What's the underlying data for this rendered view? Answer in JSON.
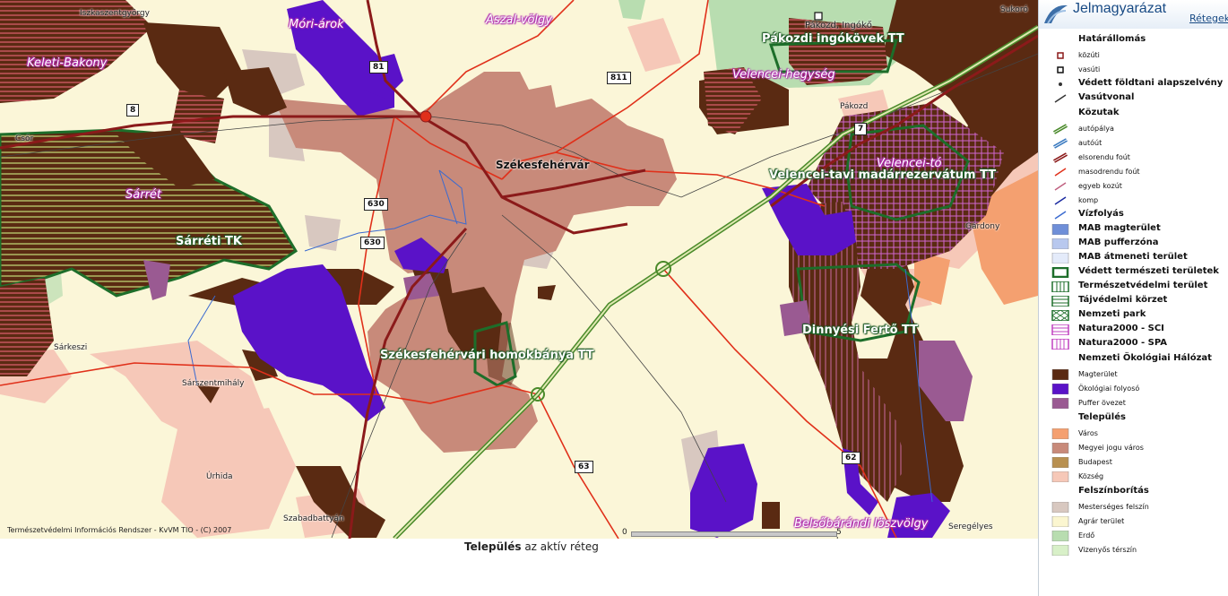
{
  "map": {
    "labels": {
      "iszkaszentgyorgy": "Iszkaszentgyörgy",
      "mori_arok": "Móri-árok",
      "aszal_volgy": "Aszal-völgy",
      "sukoro": "Sukoró",
      "pakozd_ingoko": "Pákozd, Ingókő",
      "pakozdi_ingokovek": "Pákozdi ingókövek TT",
      "keleti_bakony": "Keleti-Bakony",
      "velencei_hegyseg": "Velencei-hegység",
      "pakozd": "Pákozd",
      "csor": "Csór",
      "szekesfehervar": "Székesfehérvár",
      "velencei_to": "Velencei-tó",
      "velencei_tavi": "Velencei-tavi madárrezervátum TT",
      "sarret": "Sárrét",
      "gardony": "Gárdony",
      "sarreti_tk": "Sárréti TK",
      "dinnyesi_ferto": "Dinnyési Fertő TT",
      "sarkeszi": "Sárkeszi",
      "homokbanya": "Székesfehérvári homokbánya TT",
      "sarszentmihaly": "Sárszentmihály",
      "urhida": "Úrhida",
      "szabadbattyan": "Szabadbattyán",
      "belsobarandi": "Belsőbárándi löszvölgy",
      "seregelyes": "Seregélyes"
    },
    "road_shields": {
      "r81": "81",
      "r811": "811",
      "r8": "8",
      "r7": "7",
      "r630a": "630",
      "r630b": "630",
      "r63": "63",
      "r62": "62"
    },
    "copyright": "Természetvédelmi Információs Rendszer - KvVM TIO - (C) 2007",
    "scale_zero": "0",
    "scale_end": "5 km"
  },
  "status": {
    "active_layer": "Település",
    "suffix": " az aktív réteg"
  },
  "legend": {
    "title": "Jelmagyarázat",
    "tab_link": "Rétegek",
    "items": [
      {
        "kind": "section",
        "label": "Határállomás"
      },
      {
        "kind": "item",
        "label": "közúti",
        "symbol": "square-border",
        "color": "#8b1a1a"
      },
      {
        "kind": "item",
        "label": "vasúti",
        "symbol": "square-border",
        "color": "#111111"
      },
      {
        "kind": "item",
        "label": "Védett földtani alapszelvény",
        "symbol": "dot",
        "color": "#333333",
        "big": true
      },
      {
        "kind": "item",
        "label": "Vasútvonal",
        "symbol": "line",
        "color": "#333333",
        "big": true
      },
      {
        "kind": "section",
        "label": "Közutak"
      },
      {
        "kind": "item",
        "label": "autópálya",
        "symbol": "road",
        "color": "#4a8a2a"
      },
      {
        "kind": "item",
        "label": "autóút",
        "symbol": "road",
        "color": "#3a7ac0"
      },
      {
        "kind": "item",
        "label": "elsorendu foút",
        "symbol": "road",
        "color": "#8b1a1a"
      },
      {
        "kind": "item",
        "label": "masodrendu foút",
        "symbol": "line",
        "color": "#e0301a"
      },
      {
        "kind": "item",
        "label": "egyeb kozút",
        "symbol": "line",
        "color": "#c06080"
      },
      {
        "kind": "item",
        "label": "komp",
        "symbol": "line",
        "color": "#1a2aa0"
      },
      {
        "kind": "item",
        "label": "Vízfolyás",
        "symbol": "line",
        "color": "#3a6ad0",
        "big": true
      },
      {
        "kind": "item",
        "label": "MAB magterület",
        "symbol": "fill",
        "color": "#6f8fd8",
        "big": true
      },
      {
        "kind": "item",
        "label": "MAB pufferzóna",
        "symbol": "fill",
        "color": "#b8c8ee",
        "big": true
      },
      {
        "kind": "item",
        "label": "MAB átmeneti terület",
        "symbol": "fill",
        "color": "#e4ebfa",
        "big": true
      },
      {
        "kind": "item",
        "label": "Védett természeti területek",
        "symbol": "outline",
        "color": "#1d6e2a",
        "big": true
      },
      {
        "kind": "item",
        "label": "Természetvédelmi terület",
        "symbol": "vhatch",
        "color": "#1d6e2a",
        "big": true
      },
      {
        "kind": "item",
        "label": "Tájvédelmi körzet",
        "symbol": "hhatch",
        "color": "#1d6e2a",
        "big": true
      },
      {
        "kind": "item",
        "label": "Nemzeti park",
        "symbol": "cross",
        "color": "#1d6e2a",
        "big": true
      },
      {
        "kind": "item",
        "label": "Natura2000 - SCI",
        "symbol": "hhatch",
        "color": "#c040c0",
        "big": true
      },
      {
        "kind": "item",
        "label": "Natura2000 - SPA",
        "symbol": "vhatch",
        "color": "#c040c0",
        "big": true
      },
      {
        "kind": "section",
        "label": "Nemzeti Ökológiai Hálózat"
      },
      {
        "kind": "item",
        "label": "Magterület",
        "symbol": "fill",
        "color": "#5a2a12"
      },
      {
        "kind": "item",
        "label": "Ökológiai folyosó",
        "symbol": "fill",
        "color": "#5a12c8"
      },
      {
        "kind": "item",
        "label": "Puffer övezet",
        "symbol": "fill",
        "color": "#9a5a92"
      },
      {
        "kind": "section",
        "label": "Település"
      },
      {
        "kind": "item",
        "label": "Város",
        "symbol": "fill",
        "color": "#f4a070"
      },
      {
        "kind": "item",
        "label": "Megyei jogu város",
        "symbol": "fill",
        "color": "#c88a7a"
      },
      {
        "kind": "item",
        "label": "Budapest",
        "symbol": "fill",
        "color": "#b89050"
      },
      {
        "kind": "item",
        "label": "Község",
        "symbol": "fill",
        "color": "#f6c8b8"
      },
      {
        "kind": "section",
        "label": "Felszínborítás"
      },
      {
        "kind": "item",
        "label": "Mesterséges felszín",
        "symbol": "fill",
        "color": "#d8c8c0"
      },
      {
        "kind": "item",
        "label": "Agrár terület",
        "symbol": "fill",
        "color": "#fbf6d0"
      },
      {
        "kind": "item",
        "label": "Erdő",
        "symbol": "fill",
        "color": "#b8ddb0"
      },
      {
        "kind": "item",
        "label": "Vizenyős térszín",
        "symbol": "fill",
        "color": "#d8f0c8"
      }
    ]
  },
  "colors": {
    "agrar": "#fbf6d8",
    "magterulet": "#5a2a12",
    "folyoso": "#5a12c8",
    "puffer": "#9a5a92",
    "megyei_jogu_varos": "#c88a7a",
    "kozseg": "#f6c8b8",
    "erdo": "#b8ddb0",
    "mesterseges": "#d8c8c0",
    "protected_green": "#1d6e2a",
    "natura": "#c040c0",
    "road_primary": "#8b1a1a",
    "road_secondary": "#e0301a",
    "water": "#3a6ad0"
  }
}
